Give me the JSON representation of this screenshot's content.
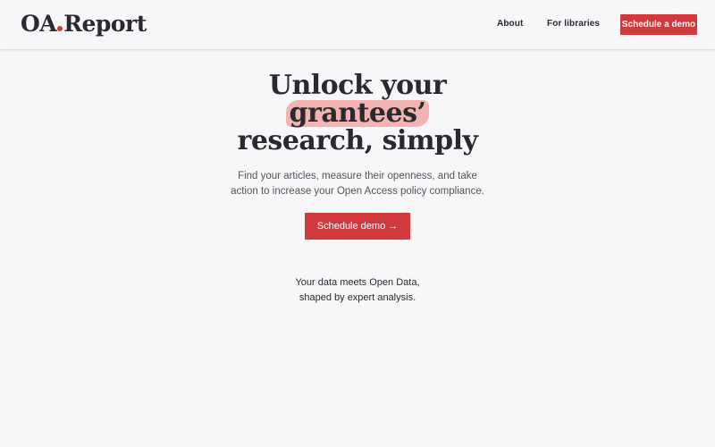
{
  "header": {
    "logo": {
      "part1": "OA",
      "part2": "Report",
      "dot_color": "#d0393e"
    },
    "nav": [
      {
        "label": "About"
      },
      {
        "label": "For libraries"
      }
    ],
    "cta_label": "Schedule a demo"
  },
  "hero": {
    "title_line1": "Unlock your",
    "title_highlight": "grantees’",
    "title_line3": "research, simply",
    "subtitle": "Find your articles, measure their openness, and take action to increase your Open Access policy compliance.",
    "cta_label": "Schedule demo →"
  },
  "tagline": {
    "line1": "Your data meets Open Data,",
    "line2": "shaped by expert analysis."
  },
  "colors": {
    "accent": "#d0393e",
    "highlight": "#f2b3b3",
    "background": "#f7f7f9",
    "text": "#2a2a2e"
  }
}
